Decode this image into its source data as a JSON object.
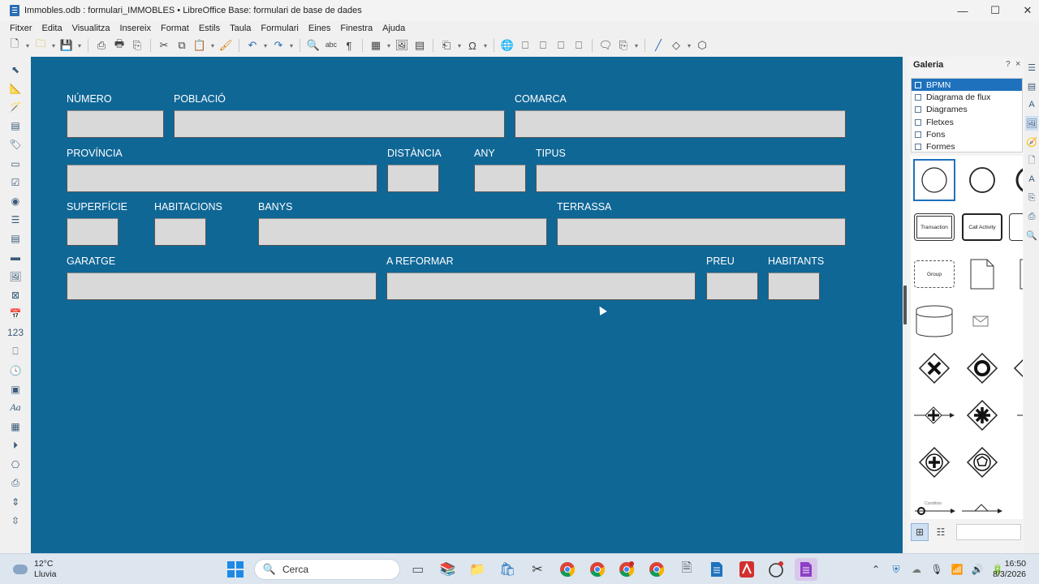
{
  "window": {
    "title": "Immobles.odb : formulari_IMMOBLES • LibreOffice Base: formulari de base de dades",
    "minimize": "—",
    "maximize": "☐",
    "close": "✕"
  },
  "menu": [
    "Fitxer",
    "Edita",
    "Visualitza",
    "Insereix",
    "Format",
    "Estils",
    "Taula",
    "Formulari",
    "Eines",
    "Finestra",
    "Ajuda"
  ],
  "form": {
    "background": "#0f6796",
    "fields": {
      "numero": "NÚMERO",
      "poblacio": "POBLACIÓ",
      "comarca": "COMARCA",
      "provincia": "PROVÍNCIA",
      "distancia": "DISTÀNCIA",
      "any": "ANY",
      "tipus": "TIPUS",
      "superficie": "SUPERFÍCIE",
      "habitacions": "HABITACIONS",
      "banys": "BANYS",
      "terrassa": "TERRASSA",
      "garatge": "GARATGE",
      "a_reformar": "A REFORMAR",
      "preu": "PREU",
      "habitants": "HABITANTS"
    }
  },
  "gallery": {
    "title": "Galeria",
    "help": "?",
    "close": "×",
    "themes": [
      "BPMN",
      "Diagrama de flux",
      "Diagrames",
      "Fletxes",
      "Fons",
      "Formes"
    ],
    "selected_theme": "BPMN",
    "items": {
      "transaction": "Transaction",
      "call_activity": "Call Activity",
      "group": "Group",
      "condition": "Condition"
    }
  },
  "taskbar": {
    "temperature": "12°C",
    "weather": "Lluvia",
    "search_placeholder": "Cerca",
    "time": "16:50",
    "date": "8/3/2026"
  },
  "colors": {
    "accent": "#1e72bd",
    "form_bg": "#0f6796",
    "field_bg": "#d9d9d9"
  }
}
